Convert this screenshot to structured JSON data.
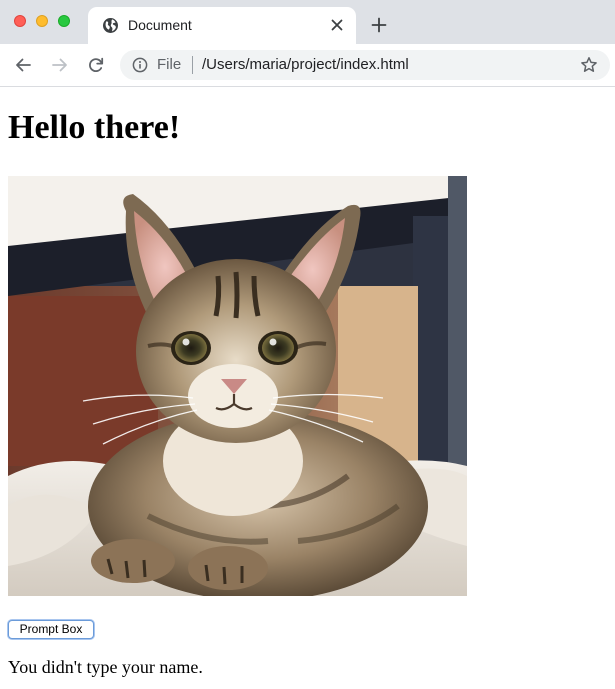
{
  "browser": {
    "tab": {
      "title": "Document",
      "favicon": "globe-icon"
    },
    "address_bar": {
      "scheme_label": "File",
      "url": "/Users/maria/project/index.html"
    },
    "icons": {
      "close": "close-icon",
      "new_tab": "plus-icon",
      "back": "back-arrow-icon",
      "forward": "forward-arrow-icon",
      "reload": "reload-icon",
      "info": "info-icon",
      "bookmark": "star-icon"
    },
    "traffic_lights": {
      "close": "#ff5f57",
      "minimize": "#febc2e",
      "zoom": "#28c840"
    }
  },
  "page": {
    "heading": "Hello there!",
    "image": {
      "subject": "tabby kitten photo"
    },
    "prompt_button_label": "Prompt Box",
    "status_text": "You didn't type your name."
  }
}
